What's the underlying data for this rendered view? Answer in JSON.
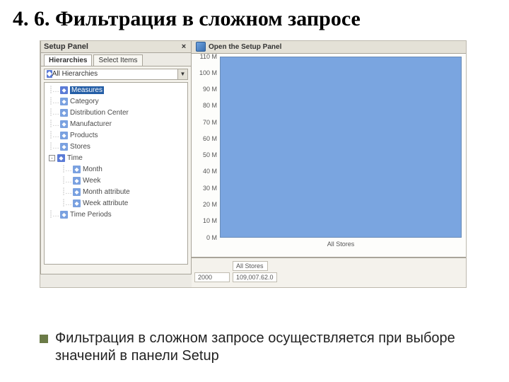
{
  "slide": {
    "title": "4. 6. Фильтрация в сложном запросе",
    "bullet": "Фильтрация в сложном запросе осуществляется при выборе значений в панели Setup"
  },
  "setup_panel": {
    "title": "Setup Panel",
    "close": "×",
    "tabs": {
      "hierarchies": "Hierarchies",
      "select_items": "Select Items"
    },
    "combo_label": "All Hierarchies"
  },
  "tree": {
    "items": [
      {
        "icon": "cube",
        "label": "Measures",
        "selected": true,
        "indent": 0
      },
      {
        "icon": "cube2",
        "label": "Category",
        "indent": 0
      },
      {
        "icon": "cube2",
        "label": "Distribution Center",
        "indent": 0
      },
      {
        "icon": "cube2",
        "label": "Manufacturer",
        "indent": 0
      },
      {
        "icon": "cube2",
        "label": "Products",
        "indent": 0
      },
      {
        "icon": "cube2",
        "label": "Stores",
        "indent": 0
      },
      {
        "icon": "cube",
        "label": "Time",
        "indent": 0,
        "expander": "-"
      },
      {
        "icon": "cube2",
        "label": "Month",
        "indent": 1
      },
      {
        "icon": "cube2",
        "label": "Week",
        "indent": 1
      },
      {
        "icon": "cube2",
        "label": "Month attribute",
        "indent": 1
      },
      {
        "icon": "cube2",
        "label": "Week attribute",
        "indent": 1
      },
      {
        "icon": "cube2",
        "label": "Time Periods",
        "indent": 0
      }
    ]
  },
  "toolbar": {
    "open_label": "Open the Setup Panel"
  },
  "chart_data": {
    "type": "bar",
    "categories": [
      "All Stores"
    ],
    "values": [
      109007.62
    ],
    "title": "",
    "xlabel": "All Stores",
    "ylabel": "",
    "ylim": [
      0,
      110
    ],
    "y_ticks": [
      "110 M",
      "100 M",
      "90 M",
      "80 M",
      "70 M",
      "60 M",
      "50 M",
      "40 M",
      "30 M",
      "20 M",
      "10 M",
      "0 M"
    ]
  },
  "grid": {
    "header": "All Stores",
    "row_label": "2000",
    "row_value": "109,007.62.0"
  }
}
